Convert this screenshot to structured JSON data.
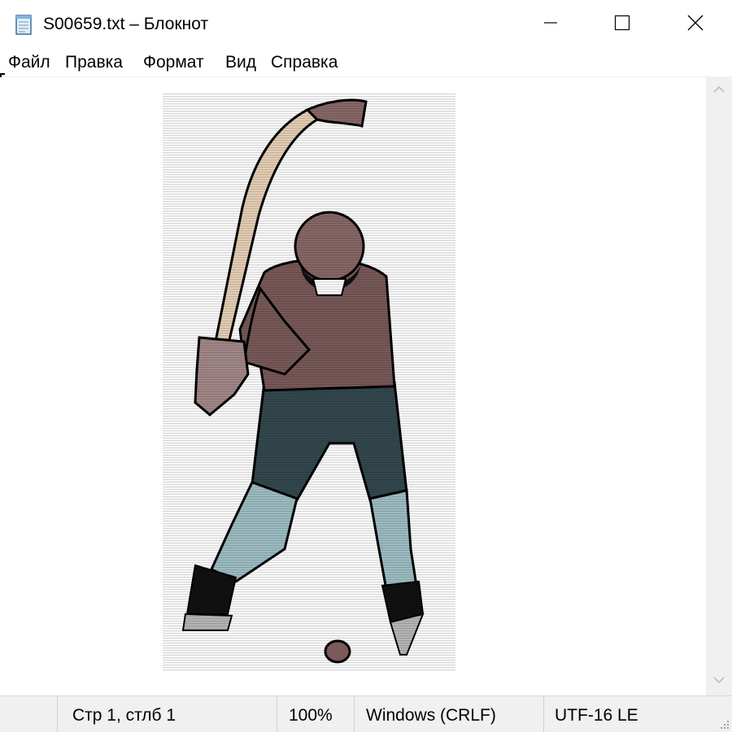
{
  "window": {
    "title": "S00659.txt – Блокнот",
    "app_icon": "notepad-icon",
    "caption_buttons": [
      "minimize-icon",
      "maximize-icon",
      "close-icon"
    ]
  },
  "menu": {
    "items": [
      {
        "label": "Файл"
      },
      {
        "label": "Правка"
      },
      {
        "label": "Формат"
      },
      {
        "label": "Вид"
      },
      {
        "label": "Справка"
      }
    ]
  },
  "content": {
    "picture": "hockey-player-illustration",
    "colors": {
      "jersey": "#7a5a5a",
      "helmet": "#8a6868",
      "pants": "#34494f",
      "shins": "#9fc0c6",
      "stick_shaft": "#e8d2b8",
      "stick_blade": "#8a6a68",
      "gloves": "#a58a8a"
    }
  },
  "scrollbar": {
    "up_icon": "chevron-up-icon",
    "down_icon": "chevron-down-icon"
  },
  "status": {
    "position": "Стр 1, стлб 1",
    "zoom": "100%",
    "line_endings": "Windows (CRLF)",
    "encoding": "UTF-16 LE",
    "grip_icon": "resize-grip-icon"
  }
}
